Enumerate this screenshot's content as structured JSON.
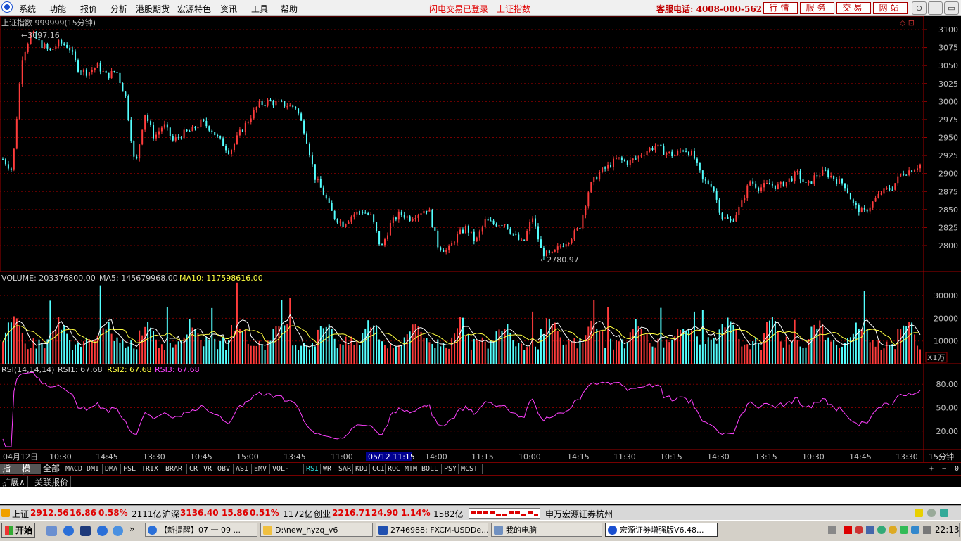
{
  "menu": [
    "系统",
    "功能",
    "报价",
    "分析",
    "港股期货",
    "宏源特色",
    "资讯",
    "工具",
    "帮助"
  ],
  "alerts": [
    "闪电交易已登录",
    "上证指数"
  ],
  "phone": "客服电话: 4008-000-562",
  "top_buttons": [
    "行情",
    "服务",
    "交易",
    "网站"
  ],
  "window_buttons": [
    "⊙",
    "−",
    "▭",
    "✕"
  ],
  "chart_data": {
    "type": "candlestick",
    "title": "上证指数 999999(15分钟)",
    "y_ticks": [
      "3100",
      "3075",
      "3050",
      "3025",
      "3000",
      "2975",
      "2950",
      "2925",
      "2900",
      "2875",
      "2850",
      "2825",
      "2800"
    ],
    "max_label": "3097.16",
    "min_label": "2780.97",
    "max_value": 3097.16,
    "min_value": 2780.97,
    "last_value": 2912.56,
    "volume_header": {
      "label": "VOLUME: 203376800.00",
      "ma5": "MA5: 145679968.00",
      "ma10": "MA10: 117598616.00"
    },
    "volume_ticks": [
      "30000",
      "20000",
      "10000"
    ],
    "volume_unit": "X1万",
    "rsi_header": {
      "label": "RSI(14,14,14)",
      "rsi1": "RSI1: 67.68",
      "rsi2": "RSI2: 67.68",
      "rsi3": "RSI3: 67.68"
    },
    "rsi_ticks": [
      "80.00",
      "50.00",
      "20.00"
    ],
    "time_labels": [
      "04月12日",
      "10:30",
      "14:45",
      "13:30",
      "10:45",
      "15:00",
      "13:45",
      "11:00",
      "05/12 11:15",
      "14:00",
      "11:15",
      "10:00",
      "14:15",
      "11:30",
      "10:15",
      "14:30",
      "13:15",
      "10:30",
      "14:45",
      "13:30"
    ],
    "period": "15分钟",
    "price_anchors": [
      2920,
      2905,
      3060,
      3095,
      3080,
      3070,
      3082,
      3076,
      3045,
      3040,
      3050,
      3035,
      3043,
      3005,
      2907,
      2985,
      2950,
      2968,
      2945,
      2955,
      2960,
      2972,
      2962,
      2945,
      2930,
      2955,
      2975,
      2995,
      3000,
      2998,
      2995,
      2992,
      2955,
      2895,
      2870,
      2840,
      2830,
      2843,
      2848,
      2840,
      2795,
      2830,
      2845,
      2838,
      2846,
      2852,
      2800,
      2792,
      2813,
      2825,
      2805,
      2834,
      2830,
      2832,
      2815,
      2802,
      2840,
      2790,
      2786,
      2800,
      2810,
      2826,
      2880,
      2900,
      2910,
      2921,
      2915,
      2921,
      2932,
      2938,
      2930,
      2925,
      2935,
      2925,
      2890,
      2885,
      2840,
      2833,
      2855,
      2890,
      2880,
      2885,
      2882,
      2890,
      2900,
      2882,
      2898,
      2902,
      2892,
      2885,
      2855,
      2845,
      2860,
      2875,
      2880,
      2900,
      2905,
      2912.56
    ]
  },
  "indicator_tabs": [
    "指标",
    "模板",
    "全部",
    "MACD",
    "DMI",
    "DMA",
    "FSL",
    "TRIX",
    "BRAR",
    "CR",
    "VR",
    "OBV",
    "ASI",
    "EMV",
    "VOL-TDX",
    "RSI",
    "WR",
    "SAR",
    "KDJ",
    "CCI",
    "ROC",
    "MTM",
    "BOLL",
    "PSY",
    "MCST"
  ],
  "active_tab": "RSI",
  "right_controls": [
    "+",
    "−",
    "0"
  ],
  "sub_tabs": [
    "扩展∧",
    "关联报价"
  ],
  "status": {
    "sh_name": "上证",
    "sh_value": "2912.56",
    "sh_change": "16.86",
    "sh_pct": "0.58%",
    "sh_amount": "2111亿",
    "hs_name": "沪深",
    "hs_value": "3136.40",
    "hs_change": "15.86",
    "hs_pct": "0.51%",
    "hs_amount": "1172亿",
    "cy_name": "创业",
    "cy_value": "2216.71",
    "cy_change": "24.90",
    "cy_pct": "1.14%",
    "cy_amount": "1582亿",
    "broker": "申万宏源证券杭州一"
  },
  "taskbar": {
    "start": "开始",
    "items": [
      "【新提醒】07 一 09 ...",
      "D:\\new_hyzq_v6",
      "2746988: FXCM-USDDe...",
      "我的电脑",
      "宏源证券增强版V6.48..."
    ],
    "clock": "22:13"
  }
}
